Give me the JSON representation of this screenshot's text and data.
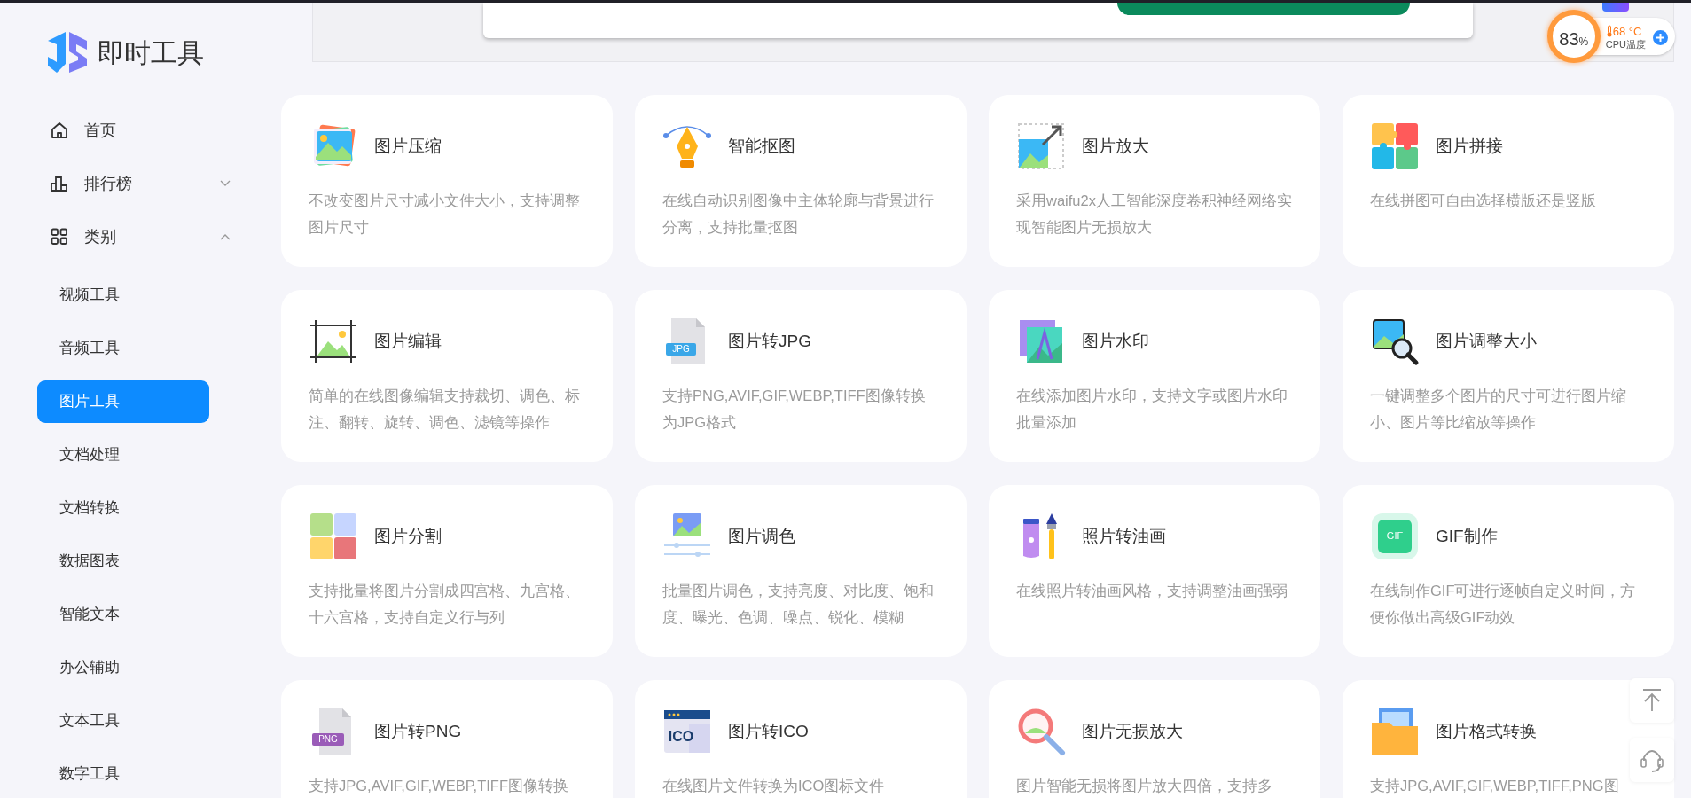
{
  "sidebar": {
    "logo": {
      "text": "即时工具"
    },
    "items": [
      {
        "label": "首页",
        "kind": "link"
      },
      {
        "label": "排行榜",
        "kind": "group",
        "expanded": false
      },
      {
        "label": "类别",
        "kind": "group",
        "expanded": true,
        "children": [
          {
            "label": "视频工具",
            "selected": false
          },
          {
            "label": "音频工具",
            "selected": false
          },
          {
            "label": "图片工具",
            "selected": true
          },
          {
            "label": "文档处理",
            "selected": false
          },
          {
            "label": "文档转换",
            "selected": false
          },
          {
            "label": "数据图表",
            "selected": false
          },
          {
            "label": "智能文本",
            "selected": false
          },
          {
            "label": "办公辅助",
            "selected": false
          },
          {
            "label": "文本工具",
            "selected": false
          },
          {
            "label": "数字工具",
            "selected": false
          }
        ]
      }
    ]
  },
  "cpu_widget": {
    "usage_value": "83",
    "usage_unit": "%",
    "temperature": "68 °C",
    "label": "CPU温度"
  },
  "cards": [
    {
      "title": "图片压缩",
      "description": "不改变图片尺寸减小文件大小，支持调整图片尺寸"
    },
    {
      "title": "智能抠图",
      "description": "在线自动识别图像中主体轮廓与背景进行分离，支持批量抠图"
    },
    {
      "title": "图片放大",
      "description": "采用waifu2x人工智能深度卷积神经网络实现智能图片无损放大"
    },
    {
      "title": "图片拼接",
      "description": "在线拼图可自由选择横版还是竖版"
    },
    {
      "title": "图片编辑",
      "description": "简单的在线图像编辑支持裁切、调色、标注、翻转、旋转、调色、滤镜等操作"
    },
    {
      "title": "图片转JPG",
      "description": "支持PNG,AVIF,GIF,WEBP,TIFF图像转换为JPG格式",
      "icon_label": "JPG"
    },
    {
      "title": "图片水印",
      "description": "在线添加图片水印，支持文字或图片水印批量添加"
    },
    {
      "title": "图片调整大小",
      "description": "一键调整多个图片的尺寸可进行图片缩小、图片等比缩放等操作"
    },
    {
      "title": "图片分割",
      "description": "支持批量将图片分割成四宫格、九宫格、十六宫格，支持自定义行与列"
    },
    {
      "title": "图片调色",
      "description": "批量图片调色，支持亮度、对比度、饱和度、曝光、色调、噪点、锐化、模糊"
    },
    {
      "title": "照片转油画",
      "description": "在线照片转油画风格，支持调整油画强弱"
    },
    {
      "title": "GIF制作",
      "description": "在线制作GIF可进行逐帧自定义时间，方便你做出高级GIF动效",
      "icon_label": "GIF"
    },
    {
      "title": "图片转PNG",
      "description": "支持JPG,AVIF,GIF,WEBP,TIFF图像转换",
      "icon_label": "PNG"
    },
    {
      "title": "图片转ICO",
      "description": "在线图片文件转换为ICO图标文件",
      "icon_label": "ICO"
    },
    {
      "title": "图片无损放大",
      "description": "图片智能无损将图片放大四倍，支持多"
    },
    {
      "title": "图片格式转换",
      "description": "支持JPG,AVIF,GIF,WEBP,TIFF,PNG图"
    }
  ]
}
